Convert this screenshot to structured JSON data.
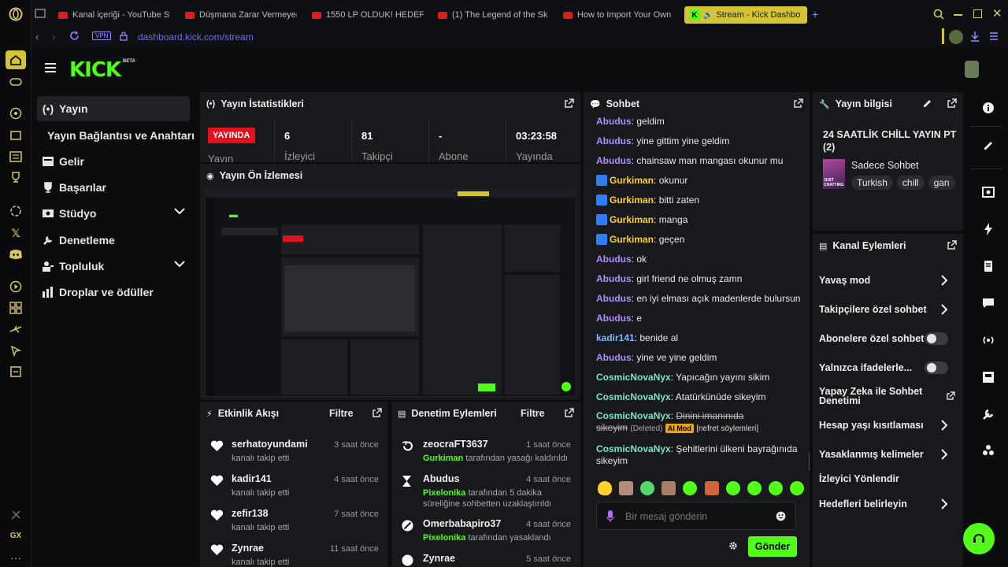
{
  "browser": {
    "tabs": [
      {
        "label": "Kanal içeriği - YouTube Stu"
      },
      {
        "label": "Düşmana Zarar Vermeyen"
      },
      {
        "label": "1550 LP OLDUK! HEDEFL"
      },
      {
        "label": "(1) The Legend of the Sk"
      },
      {
        "label": "How to Import Your Own"
      },
      {
        "label": "Stream - Kick Dashbo"
      }
    ],
    "vpn_label": "VPN",
    "url": "dashboard.kick.com/stream",
    "gx_label": "GX"
  },
  "kick": {
    "logo": "KICK",
    "beta": "BETA"
  },
  "nav": {
    "items": [
      {
        "label": "Yayın"
      },
      {
        "label": "Yayın Bağlantısı ve Anahtarı"
      },
      {
        "label": "Gelir"
      },
      {
        "label": "Başarılar"
      },
      {
        "label": "Stüdyo"
      },
      {
        "label": "Denetleme"
      },
      {
        "label": "Topluluk"
      },
      {
        "label": "Droplar ve ödüller"
      }
    ]
  },
  "stats": {
    "title": "Yayın İstatistikleri",
    "live_badge": "YAYINDA",
    "live_label": "Yayın",
    "viewers": "6",
    "viewers_label": "İzleyici",
    "followers": "81",
    "followers_label": "Takipçi",
    "subs": "-",
    "subs_label": "Abone",
    "uptime": "03:23:58",
    "uptime_label": "Yayında"
  },
  "preview": {
    "title": "Yayın Ön İzlemesi"
  },
  "activity": {
    "title": "Etkinlik Akışı",
    "filter": "Filtre",
    "items": [
      {
        "name": "serhatoyundami",
        "desc": "kanalı takip etti",
        "time": "3 saat önce"
      },
      {
        "name": "kadir141",
        "desc": "kanalı takip etti",
        "time": "4 saat önce"
      },
      {
        "name": "zefir138",
        "desc": "kanalı takip etti",
        "time": "7 saat önce"
      },
      {
        "name": "Zynrae",
        "desc": "kanalı takip etti",
        "time": "11 saat önce"
      }
    ]
  },
  "moderation": {
    "title": "Denetim Eylemleri",
    "filter": "Filtre",
    "items": [
      {
        "name": "zeocraFT3637",
        "actor": "Gurkiman",
        "desc": "tarafından yasağı kaldırıldı",
        "time": "1 saat önce"
      },
      {
        "name": "Abudus",
        "actor": "Pixelonika",
        "desc": "tarafından 5 dakika süreliğine sohbetten uzaklaştırıldı",
        "time": "4 saat önce"
      },
      {
        "name": "Omerbabapiro37",
        "actor": "Pixelonika",
        "desc": "tarafından yasaklandı",
        "time": "4 saat önce"
      },
      {
        "name": "Zynrae",
        "actor": "",
        "desc": "",
        "time": "5 saat önce"
      }
    ]
  },
  "chat": {
    "title": "Sohbet",
    "messages": [
      {
        "user": "Abudus",
        "type": "ab",
        "text": "geldim"
      },
      {
        "user": "Abudus",
        "type": "ab",
        "text": "yine gittim yine geldim"
      },
      {
        "user": "Abudus",
        "type": "ab",
        "text": "chainsaw man mangası okunur mu"
      },
      {
        "user": "Gurkiman",
        "type": "gk",
        "text": "okunur"
      },
      {
        "user": "Gurkiman",
        "type": "gk",
        "text": "bitti zaten"
      },
      {
        "user": "Gurkiman",
        "type": "gk",
        "text": "manga"
      },
      {
        "user": "Gurkiman",
        "type": "gk",
        "text": "geçen"
      },
      {
        "user": "Abudus",
        "type": "ab",
        "text": "ok"
      },
      {
        "user": "Abudus",
        "type": "ab",
        "text": "girl friend ne olmuş zamn"
      },
      {
        "user": "Abudus",
        "type": "ab",
        "text": "en iyi elması açık madenlerde bulursun"
      },
      {
        "user": "Abudus",
        "type": "ab",
        "text": "e"
      },
      {
        "user": "kadir141",
        "type": "kd",
        "text": "benide al"
      },
      {
        "user": "Abudus",
        "type": "ab",
        "text": "yine ve yine geldim"
      },
      {
        "user": "CosmicNovaNyx",
        "type": "cn",
        "text": "Yapıcağın yayını sikim"
      },
      {
        "user": "CosmicNovaNyx",
        "type": "cn",
        "text": "Atatürkünüde sikeyim"
      }
    ],
    "deleted_user": "CosmicNovaNyx",
    "deleted_text_1": "Dinini imanınıda",
    "deleted_text_2": "sikeyim",
    "deleted_label": "(Deleted)",
    "ai_mod": "AI Mod",
    "ai_reason": "[nefret söylemleri]",
    "last_user": "CosmicNovaNyx",
    "last_text": "Şehitlerini ülkeni bayrağınıda sikeyim",
    "input_placeholder": "Bir mesaj gönderin",
    "send": "Gönder"
  },
  "stream_info": {
    "title": "Yayın bilgisi",
    "stream_title": "24 SAATLİK CHİLL YAYIN PT (2)",
    "category": "Sadece Sohbet",
    "thumb_text": "JUST CHATTING",
    "tags": [
      "Turkish",
      "chill",
      "gan"
    ]
  },
  "channel_actions": {
    "title": "Kanal Eylemleri",
    "items": [
      {
        "label": "Yavaş mod",
        "kind": "chevron"
      },
      {
        "label": "Takipçilere özel sohbet",
        "kind": "chevron"
      },
      {
        "label": "Abonelere özel sohbet",
        "kind": "toggle"
      },
      {
        "label": "Yalnızca ifadelerle...",
        "kind": "toggle"
      },
      {
        "label": "Yapay Zeka ile Sohbet Denetimi",
        "kind": "external"
      },
      {
        "label": "Hesap yaşı kısıtlaması",
        "kind": "chevron"
      },
      {
        "label": "Yasaklanmış kelimeler",
        "kind": "chevron"
      },
      {
        "label": "İzleyici Yönlendir",
        "kind": "none"
      },
      {
        "label": "Hedefleri belirleyin",
        "kind": "chevron"
      }
    ]
  },
  "colors": {
    "kick_green": "#53fc18",
    "live_red": "#e1121c",
    "opera_accent": "#d3c431"
  }
}
